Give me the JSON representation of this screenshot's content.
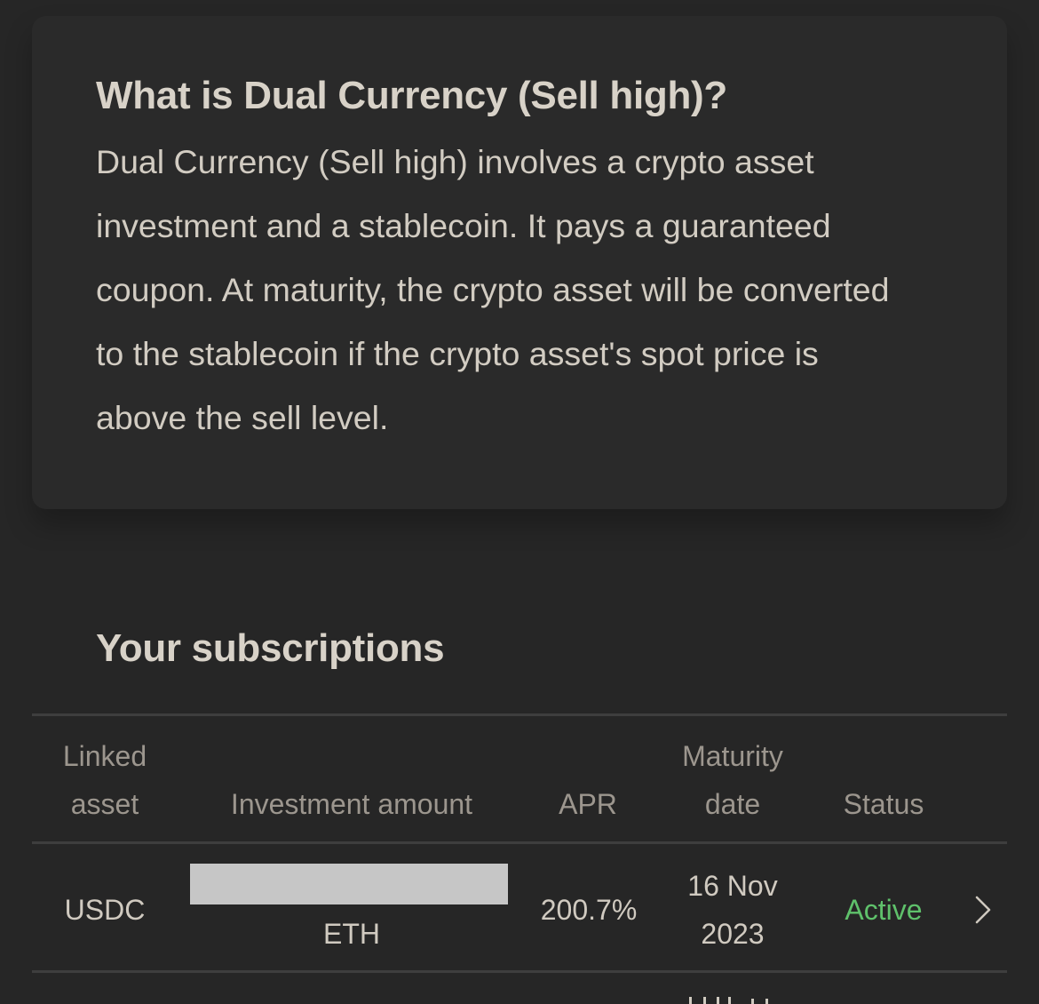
{
  "info": {
    "title": "What is Dual Currency (Sell high)?",
    "lines": [
      "Dual Currency (Sell high) involves a crypto asset",
      "investment and a stablecoin. It pays a guaranteed",
      "coupon. At maturity, the crypto asset will be converted",
      "to the stablecoin if the crypto asset's spot price is",
      "above the sell level."
    ]
  },
  "subscriptions": {
    "title": "Your subscriptions",
    "headers": {
      "linked_asset": [
        "Linked",
        "asset"
      ],
      "investment_amount": "Investment amount",
      "apr": "APR",
      "maturity_date": [
        "Maturity",
        "date"
      ],
      "status": "Status"
    },
    "rows": [
      {
        "linked_asset": "USDC",
        "investment_currency": "ETH",
        "apr": "200.7%",
        "maturity_date": [
          "16 Nov",
          "2023"
        ],
        "status": "Active"
      }
    ]
  },
  "colors": {
    "background": "#262626",
    "text_primary": "#d8d2c8",
    "text_muted": "#9c968e",
    "status_active": "#5fc16b",
    "divider": "#3e3e3e",
    "redaction": "#c6c6c6"
  },
  "icons": {
    "row_action": "chevron-right-icon"
  }
}
